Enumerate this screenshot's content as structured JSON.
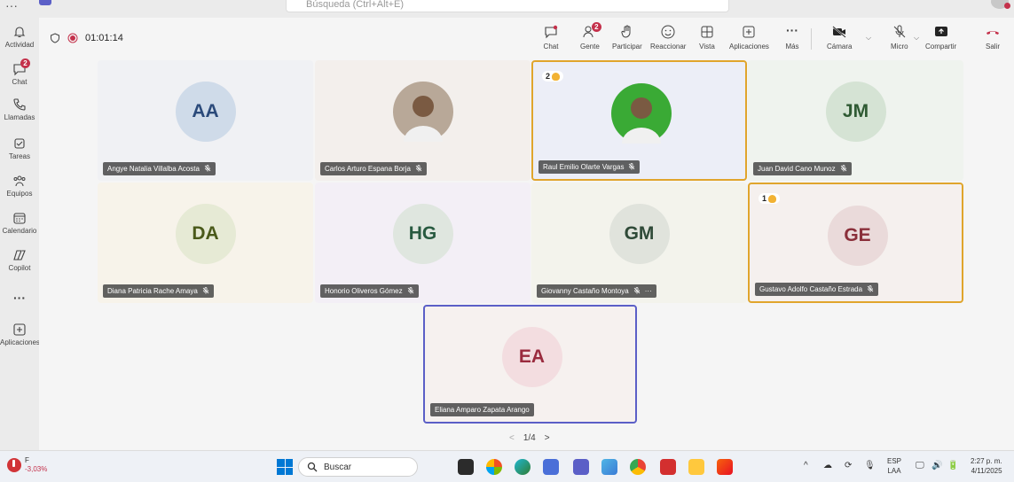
{
  "top": {
    "search_placeholder": "Búsqueda (Ctrl+Alt+E)"
  },
  "rail": [
    {
      "label": "Actividad",
      "icon": "bell-icon",
      "badge": ""
    },
    {
      "label": "Chat",
      "icon": "chat-icon",
      "badge": "2"
    },
    {
      "label": "Llamadas",
      "icon": "phone-icon",
      "badge": ""
    },
    {
      "label": "Tareas",
      "icon": "tasks-icon",
      "badge": ""
    },
    {
      "label": "Equipos",
      "icon": "teams-icon",
      "badge": ""
    },
    {
      "label": "Calendario",
      "icon": "calendar-icon",
      "badge": ""
    },
    {
      "label": "Copilot",
      "icon": "copilot-icon",
      "badge": ""
    },
    {
      "label": "",
      "icon": "more-icon",
      "badge": ""
    },
    {
      "label": "Aplicaciones",
      "icon": "apps-icon",
      "badge": ""
    }
  ],
  "meeting": {
    "timer": "01:01:14",
    "buttons": {
      "chat": "Chat",
      "gente": "Gente",
      "gente_badge": "2",
      "participar": "Participar",
      "reaccionar": "Reaccionar",
      "vista": "Vista",
      "aplicaciones": "Aplicaciones",
      "mas": "Más",
      "camara": "Cámara",
      "micro": "Micro",
      "compartir": "Compartir",
      "salir": "Salir"
    }
  },
  "participants": [
    {
      "initials": "AA",
      "name": "Angye Natalia Villalba Acosta",
      "bg": "#f0f1f4",
      "avatar_bg": "#cfdbe9",
      "avatar_fg": "#2b4a7a"
    },
    {
      "initials": "",
      "name": "Carlos Arturo Espana Borja",
      "bg": "#f3efec",
      "avatar_bg": "#b8a898",
      "avatar_fg": "#333"
    },
    {
      "initials": "",
      "name": "Raul Emilio Olarte Vargas",
      "bg": "#eceef7",
      "avatar_bg": "#3aaa35",
      "avatar_fg": "#fff",
      "hand": "2"
    },
    {
      "initials": "JM",
      "name": "Juan David Cano Munoz",
      "bg": "#eff3ee",
      "avatar_bg": "#d5e3d4",
      "avatar_fg": "#2f5a33"
    },
    {
      "initials": "DA",
      "name": "Diana Patricia Rache Amaya",
      "bg": "#f7f3ea",
      "avatar_bg": "#e6ead5",
      "avatar_fg": "#4a5a1a"
    },
    {
      "initials": "HG",
      "name": "Honorio Oliveros Gómez",
      "bg": "#f3eff6",
      "avatar_bg": "#dfe6df",
      "avatar_fg": "#285a40"
    },
    {
      "initials": "GM",
      "name": "Giovanny Castaño Montoya",
      "bg": "#f3f3ec",
      "avatar_bg": "#e0e3dc",
      "avatar_fg": "#2f4a38"
    },
    {
      "initials": "GE",
      "name": "Gustavo Adolfo Castaño Estrada",
      "bg": "#f5f0ee",
      "avatar_bg": "#eadada",
      "avatar_fg": "#8a2f3a",
      "hand": "1"
    },
    {
      "initials": "EA",
      "name": "Eliana Amparo Zapata Arango",
      "bg": "#f6f1ef",
      "avatar_bg": "#f3dde0",
      "avatar_fg": "#9a2b3e"
    }
  ],
  "pager": {
    "label": "1/4"
  },
  "taskbar": {
    "weather_temp": "F",
    "weather_change": "-3,03%",
    "search": "Buscar",
    "lang_top": "ESP",
    "lang_bottom": "LAA",
    "time": "2:27 p. m.",
    "date": "4/11/2025"
  },
  "colors": {
    "accent": "#5b5fc7",
    "raise_hand": "#e0a52c",
    "leave": "#c4314b"
  }
}
